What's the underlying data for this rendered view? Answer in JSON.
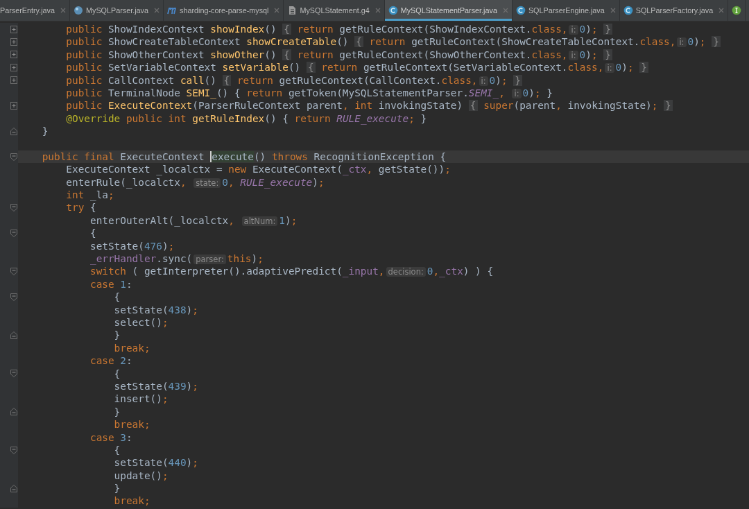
{
  "tabs": [
    {
      "label": "ParserEntry.java",
      "kind": "plain",
      "selected": false
    },
    {
      "label": "MySQLParser.java",
      "kind": "sphere",
      "selected": false
    },
    {
      "label": "sharding-core-parse-mysql",
      "kind": "module",
      "selected": false
    },
    {
      "label": "MySQLStatement.g4",
      "kind": "file",
      "selected": false
    },
    {
      "label": "MySQLStatementParser.java",
      "kind": "class",
      "selected": true
    },
    {
      "label": "SQLParserEngine.java",
      "kind": "class",
      "selected": false
    },
    {
      "label": "SQLParserFactory.java",
      "kind": "class",
      "selected": false
    },
    {
      "kind": "interface",
      "selected": false
    }
  ],
  "lines": [
    {
      "kind": "folded",
      "tokens": [
        {
          "kind": "kw",
          "text": "        public"
        },
        {
          "kind": "plain",
          "text": " ShowIndexContext "
        },
        {
          "kind": "method",
          "text": "showIndex"
        },
        {
          "kind": "plain",
          "text": "() "
        },
        {
          "kind": "fold",
          "text": "{"
        },
        {
          "kind": "kw",
          "text": " return"
        },
        {
          "kind": "plain",
          "text": " getRuleContext(ShowIndexContext."
        },
        {
          "kind": "kw",
          "text": "class,"
        },
        {
          "kind": "hint",
          "text": "i:"
        },
        {
          "kind": "num",
          "text": "0"
        },
        {
          "kind": "plain",
          "text": ")"
        },
        {
          "kind": "kw",
          "text": "; "
        },
        {
          "kind": "fold",
          "text": "}"
        }
      ]
    },
    {
      "kind": "folded",
      "tokens": [
        {
          "kind": "kw",
          "text": "        public"
        },
        {
          "kind": "plain",
          "text": " ShowCreateTableContext "
        },
        {
          "kind": "method",
          "text": "showCreateTable"
        },
        {
          "kind": "plain",
          "text": "() "
        },
        {
          "kind": "fold",
          "text": "{"
        },
        {
          "kind": "kw",
          "text": " return"
        },
        {
          "kind": "plain",
          "text": " getRuleContext(ShowCreateTableContext."
        },
        {
          "kind": "kw",
          "text": "class,"
        },
        {
          "kind": "hint",
          "text": "i:"
        },
        {
          "kind": "num",
          "text": "0"
        },
        {
          "kind": "plain",
          "text": ")"
        },
        {
          "kind": "kw",
          "text": "; "
        },
        {
          "kind": "fold",
          "text": "}"
        }
      ]
    },
    {
      "kind": "folded",
      "tokens": [
        {
          "kind": "kw",
          "text": "        public"
        },
        {
          "kind": "plain",
          "text": " ShowOtherContext "
        },
        {
          "kind": "method",
          "text": "showOther"
        },
        {
          "kind": "plain",
          "text": "() "
        },
        {
          "kind": "fold",
          "text": "{"
        },
        {
          "kind": "kw",
          "text": " return"
        },
        {
          "kind": "plain",
          "text": " getRuleContext(ShowOtherContext."
        },
        {
          "kind": "kw",
          "text": "class,"
        },
        {
          "kind": "hint",
          "text": "i:"
        },
        {
          "kind": "num",
          "text": "0"
        },
        {
          "kind": "plain",
          "text": ")"
        },
        {
          "kind": "kw",
          "text": "; "
        },
        {
          "kind": "fold",
          "text": "}"
        }
      ]
    },
    {
      "kind": "folded",
      "tokens": [
        {
          "kind": "kw",
          "text": "        public"
        },
        {
          "kind": "plain",
          "text": " SetVariableContext "
        },
        {
          "kind": "method",
          "text": "setVariable"
        },
        {
          "kind": "plain",
          "text": "() "
        },
        {
          "kind": "fold",
          "text": "{"
        },
        {
          "kind": "kw",
          "text": " return"
        },
        {
          "kind": "plain",
          "text": " getRuleContext(SetVariableContext."
        },
        {
          "kind": "kw",
          "text": "class,"
        },
        {
          "kind": "hint",
          "text": "i:"
        },
        {
          "kind": "num",
          "text": "0"
        },
        {
          "kind": "plain",
          "text": ")"
        },
        {
          "kind": "kw",
          "text": "; "
        },
        {
          "kind": "fold",
          "text": "}"
        }
      ]
    },
    {
      "kind": "folded",
      "tokens": [
        {
          "kind": "kw",
          "text": "        public"
        },
        {
          "kind": "plain",
          "text": " CallContext "
        },
        {
          "kind": "method",
          "text": "call"
        },
        {
          "kind": "plain",
          "text": "() "
        },
        {
          "kind": "fold",
          "text": "{"
        },
        {
          "kind": "kw",
          "text": " return"
        },
        {
          "kind": "plain",
          "text": " getRuleContext(CallContext."
        },
        {
          "kind": "kw",
          "text": "class,"
        },
        {
          "kind": "hint",
          "text": "i:"
        },
        {
          "kind": "num",
          "text": "0"
        },
        {
          "kind": "plain",
          "text": ")"
        },
        {
          "kind": "kw",
          "text": "; "
        },
        {
          "kind": "fold",
          "text": "}"
        }
      ]
    },
    {
      "kind": "plain",
      "tokens": [
        {
          "kind": "kw",
          "text": "        public"
        },
        {
          "kind": "plain",
          "text": " TerminalNode "
        },
        {
          "kind": "method",
          "text": "SEMI_"
        },
        {
          "kind": "plain",
          "text": "() { "
        },
        {
          "kind": "kw",
          "text": "return"
        },
        {
          "kind": "plain",
          "text": " getToken(MySQLStatementParser."
        },
        {
          "kind": "field",
          "text": "SEMI_"
        },
        {
          "kind": "kw",
          "text": ", "
        },
        {
          "kind": "hint",
          "text": "i:"
        },
        {
          "kind": "num",
          "text": "0"
        },
        {
          "kind": "plain",
          "text": ")"
        },
        {
          "kind": "kw",
          "text": ";"
        },
        {
          "kind": "plain",
          "text": " }"
        }
      ]
    },
    {
      "kind": "folded",
      "tokens": [
        {
          "kind": "kw",
          "text": "        public"
        },
        {
          "kind": "method",
          "text": " ExecuteContext"
        },
        {
          "kind": "plain",
          "text": "(ParserRuleContext parent"
        },
        {
          "kind": "kw",
          "text": ", int"
        },
        {
          "kind": "plain",
          "text": " invokingState) "
        },
        {
          "kind": "fold",
          "text": "{"
        },
        {
          "kind": "kw",
          "text": " super"
        },
        {
          "kind": "plain",
          "text": "(parent"
        },
        {
          "kind": "kw",
          "text": ","
        },
        {
          "kind": "plain",
          "text": " invokingState)"
        },
        {
          "kind": "kw",
          "text": "; "
        },
        {
          "kind": "fold",
          "text": "}"
        }
      ]
    },
    {
      "kind": "plain",
      "tokens": [
        {
          "kind": "ann",
          "text": "        @Override"
        },
        {
          "kind": "kw",
          "text": " public int"
        },
        {
          "kind": "method",
          "text": " getRuleIndex"
        },
        {
          "kind": "plain",
          "text": "() { "
        },
        {
          "kind": "kw",
          "text": "return"
        },
        {
          "kind": "field",
          "text": " RULE_execute"
        },
        {
          "kind": "kw",
          "text": ";"
        },
        {
          "kind": "plain",
          "text": " }"
        }
      ]
    },
    {
      "kind": "close",
      "tokens": [
        {
          "kind": "plain",
          "text": "    }"
        }
      ]
    },
    {
      "kind": "blank"
    },
    {
      "kind": "open",
      "current": true,
      "tokens": [
        {
          "kind": "kw",
          "text": "    public final"
        },
        {
          "kind": "plain",
          "text": " ExecuteContext "
        },
        {
          "kind": "caret",
          "text": "execute"
        },
        {
          "kind": "plain",
          "text": "() "
        },
        {
          "kind": "kw",
          "text": "throws"
        },
        {
          "kind": "plain",
          "text": " RecognitionException {"
        }
      ]
    },
    {
      "kind": "plain",
      "tokens": [
        {
          "kind": "plain",
          "text": "        ExecuteContext _localctx = "
        },
        {
          "kind": "kw",
          "text": "new"
        },
        {
          "kind": "plain",
          "text": " ExecuteContext("
        },
        {
          "kind": "member",
          "text": "_ctx"
        },
        {
          "kind": "kw",
          "text": ","
        },
        {
          "kind": "plain",
          "text": " getState())"
        },
        {
          "kind": "kw",
          "text": ";"
        }
      ]
    },
    {
      "kind": "plain",
      "tokens": [
        {
          "kind": "plain",
          "text": "        enterRule(_localctx"
        },
        {
          "kind": "kw",
          "text": ", "
        },
        {
          "kind": "hint",
          "text": "state:"
        },
        {
          "kind": "num",
          "text": "0"
        },
        {
          "kind": "kw",
          "text": ", "
        },
        {
          "kind": "field",
          "text": "RULE_execute"
        },
        {
          "kind": "plain",
          "text": ")"
        },
        {
          "kind": "kw",
          "text": ";"
        }
      ]
    },
    {
      "kind": "plain",
      "tokens": [
        {
          "kind": "kw",
          "text": "        int"
        },
        {
          "kind": "plain",
          "text": " _la"
        },
        {
          "kind": "kw",
          "text": ";"
        }
      ]
    },
    {
      "kind": "open",
      "tokens": [
        {
          "kind": "kw",
          "text": "        try"
        },
        {
          "kind": "plain",
          "text": " {"
        }
      ]
    },
    {
      "kind": "plain",
      "tokens": [
        {
          "kind": "plain",
          "text": "            enterOuterAlt(_localctx"
        },
        {
          "kind": "kw",
          "text": ", "
        },
        {
          "kind": "hint",
          "text": "altNum:"
        },
        {
          "kind": "num",
          "text": "1"
        },
        {
          "kind": "plain",
          "text": ")"
        },
        {
          "kind": "kw",
          "text": ";"
        }
      ]
    },
    {
      "kind": "open",
      "tokens": [
        {
          "kind": "plain",
          "text": "            {"
        }
      ]
    },
    {
      "kind": "plain",
      "tokens": [
        {
          "kind": "plain",
          "text": "            setState("
        },
        {
          "kind": "num",
          "text": "476"
        },
        {
          "kind": "plain",
          "text": ")"
        },
        {
          "kind": "kw",
          "text": ";"
        }
      ]
    },
    {
      "kind": "plain",
      "tokens": [
        {
          "kind": "member",
          "text": "            _errHandler"
        },
        {
          "kind": "plain",
          "text": ".sync("
        },
        {
          "kind": "hint",
          "text": "parser:"
        },
        {
          "kind": "kw",
          "text": "this"
        },
        {
          "kind": "plain",
          "text": ")"
        },
        {
          "kind": "kw",
          "text": ";"
        }
      ]
    },
    {
      "kind": "open",
      "tokens": [
        {
          "kind": "kw",
          "text": "            switch"
        },
        {
          "kind": "plain",
          "text": " ( getInterpreter().adaptivePredict("
        },
        {
          "kind": "member",
          "text": "_input"
        },
        {
          "kind": "kw",
          "text": ","
        },
        {
          "kind": "hint",
          "text": "decision:"
        },
        {
          "kind": "num",
          "text": "0"
        },
        {
          "kind": "kw",
          "text": ","
        },
        {
          "kind": "member",
          "text": "_ctx"
        },
        {
          "kind": "plain",
          "text": ") ) {"
        }
      ]
    },
    {
      "kind": "plain",
      "tokens": [
        {
          "kind": "kw",
          "text": "            case"
        },
        {
          "kind": "num",
          "text": " 1"
        },
        {
          "kind": "plain",
          "text": ":"
        }
      ]
    },
    {
      "kind": "open",
      "tokens": [
        {
          "kind": "plain",
          "text": "                {"
        }
      ]
    },
    {
      "kind": "plain",
      "tokens": [
        {
          "kind": "plain",
          "text": "                setState("
        },
        {
          "kind": "num",
          "text": "438"
        },
        {
          "kind": "plain",
          "text": ")"
        },
        {
          "kind": "kw",
          "text": ";"
        }
      ]
    },
    {
      "kind": "plain",
      "tokens": [
        {
          "kind": "plain",
          "text": "                select()"
        },
        {
          "kind": "kw",
          "text": ";"
        }
      ]
    },
    {
      "kind": "close",
      "tokens": [
        {
          "kind": "plain",
          "text": "                }"
        }
      ]
    },
    {
      "kind": "plain",
      "tokens": [
        {
          "kind": "kw",
          "text": "                break;"
        }
      ]
    },
    {
      "kind": "plain",
      "tokens": [
        {
          "kind": "kw",
          "text": "            case"
        },
        {
          "kind": "num",
          "text": " 2"
        },
        {
          "kind": "plain",
          "text": ":"
        }
      ]
    },
    {
      "kind": "open",
      "tokens": [
        {
          "kind": "plain",
          "text": "                {"
        }
      ]
    },
    {
      "kind": "plain",
      "tokens": [
        {
          "kind": "plain",
          "text": "                setState("
        },
        {
          "kind": "num",
          "text": "439"
        },
        {
          "kind": "plain",
          "text": ")"
        },
        {
          "kind": "kw",
          "text": ";"
        }
      ]
    },
    {
      "kind": "plain",
      "tokens": [
        {
          "kind": "plain",
          "text": "                insert()"
        },
        {
          "kind": "kw",
          "text": ";"
        }
      ]
    },
    {
      "kind": "close",
      "tokens": [
        {
          "kind": "plain",
          "text": "                }"
        }
      ]
    },
    {
      "kind": "plain",
      "tokens": [
        {
          "kind": "kw",
          "text": "                break;"
        }
      ]
    },
    {
      "kind": "plain",
      "tokens": [
        {
          "kind": "kw",
          "text": "            case"
        },
        {
          "kind": "num",
          "text": " 3"
        },
        {
          "kind": "plain",
          "text": ":"
        }
      ]
    },
    {
      "kind": "open",
      "tokens": [
        {
          "kind": "plain",
          "text": "                {"
        }
      ]
    },
    {
      "kind": "plain",
      "tokens": [
        {
          "kind": "plain",
          "text": "                setState("
        },
        {
          "kind": "num",
          "text": "440"
        },
        {
          "kind": "plain",
          "text": ")"
        },
        {
          "kind": "kw",
          "text": ";"
        }
      ]
    },
    {
      "kind": "plain",
      "tokens": [
        {
          "kind": "plain",
          "text": "                update()"
        },
        {
          "kind": "kw",
          "text": ";"
        }
      ]
    },
    {
      "kind": "close",
      "tokens": [
        {
          "kind": "plain",
          "text": "                }"
        }
      ]
    },
    {
      "kind": "plain",
      "tokens": [
        {
          "kind": "kw",
          "text": "                break;"
        }
      ]
    }
  ]
}
